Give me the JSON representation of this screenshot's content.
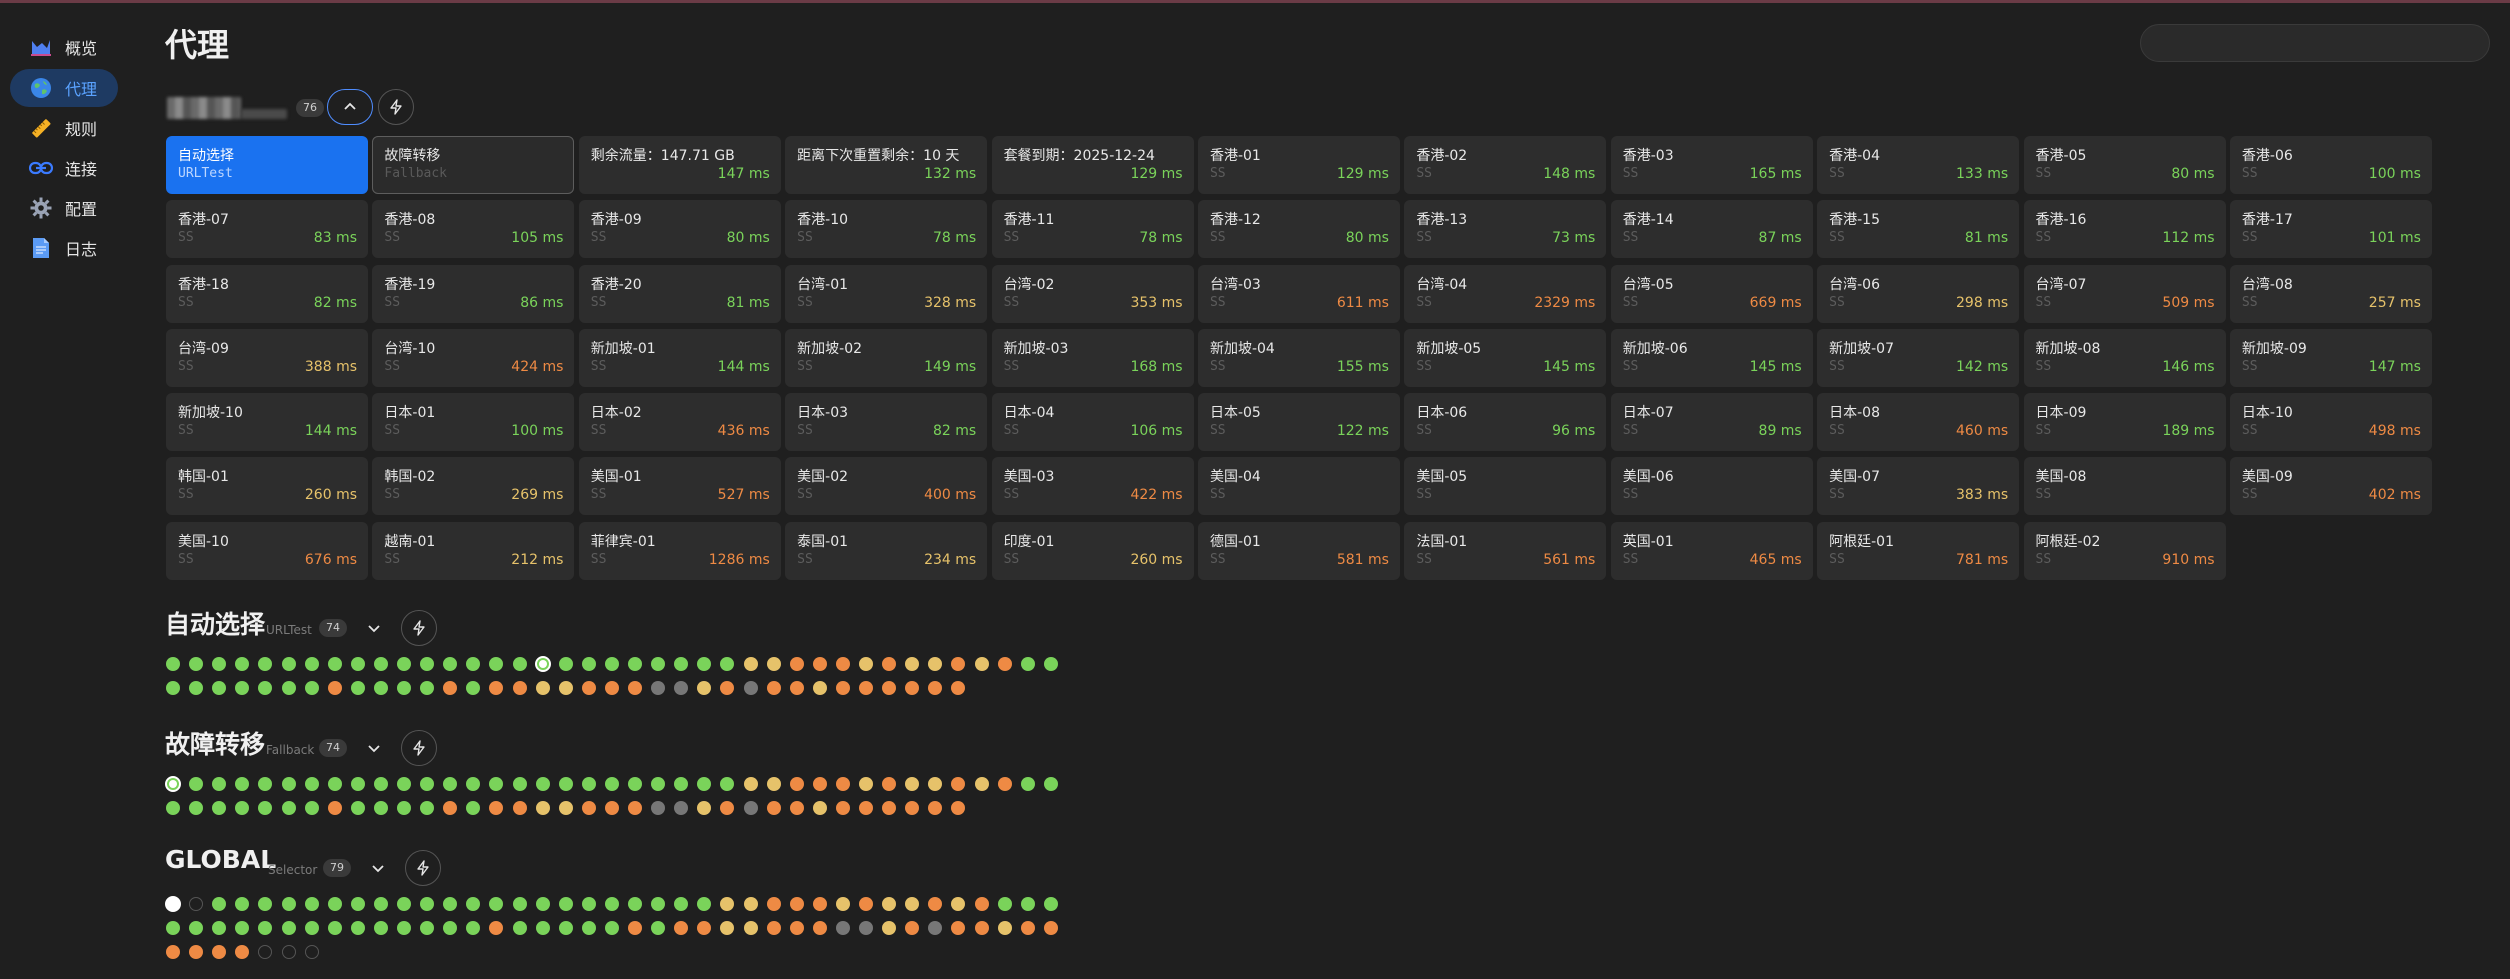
{
  "sidebar": {
    "items": [
      {
        "label": "概览",
        "icon": "chart-icon",
        "color": "#5b8cf0"
      },
      {
        "label": "代理",
        "icon": "globe-icon",
        "color": "#4aa3ff",
        "active": true
      },
      {
        "label": "规则",
        "icon": "ruler-icon",
        "color": "#f5b125"
      },
      {
        "label": "连接",
        "icon": "link-icon",
        "color": "#3b7bff"
      },
      {
        "label": "配置",
        "icon": "gear-icon",
        "color": "#9aa3b5"
      },
      {
        "label": "日志",
        "icon": "document-icon",
        "color": "#6aa6ff"
      }
    ]
  },
  "header": {
    "title": "代理",
    "search_placeholder": ""
  },
  "main_group": {
    "count": "76"
  },
  "colors": {
    "green": "#7ad35a",
    "yellow": "#e6c26a",
    "orange": "#ee8a44",
    "empty": "#555555"
  },
  "proxies": [
    {
      "name": "自动选择",
      "type": "URLTest",
      "latency": "",
      "state": "selected"
    },
    {
      "name": "故障转移",
      "type": "Fallback",
      "latency": "",
      "state": "outlined"
    },
    {
      "name": "剩余流量：147.71 GB",
      "type": "",
      "latency": "147 ms",
      "level": "green"
    },
    {
      "name": "距离下次重置剩余：10 天",
      "type": "",
      "latency": "132 ms",
      "level": "green"
    },
    {
      "name": "套餐到期：2025-12-24",
      "type": "",
      "latency": "129 ms",
      "level": "green"
    },
    {
      "name": "香港-01",
      "type": "SS",
      "latency": "129 ms",
      "level": "green"
    },
    {
      "name": "香港-02",
      "type": "SS",
      "latency": "148 ms",
      "level": "green"
    },
    {
      "name": "香港-03",
      "type": "SS",
      "latency": "165 ms",
      "level": "green"
    },
    {
      "name": "香港-04",
      "type": "SS",
      "latency": "133 ms",
      "level": "green"
    },
    {
      "name": "香港-05",
      "type": "SS",
      "latency": "80 ms",
      "level": "green"
    },
    {
      "name": "香港-06",
      "type": "SS",
      "latency": "100 ms",
      "level": "green"
    },
    {
      "name": "香港-07",
      "type": "SS",
      "latency": "83 ms",
      "level": "green"
    },
    {
      "name": "香港-08",
      "type": "SS",
      "latency": "105 ms",
      "level": "green"
    },
    {
      "name": "香港-09",
      "type": "SS",
      "latency": "80 ms",
      "level": "green"
    },
    {
      "name": "香港-10",
      "type": "SS",
      "latency": "78 ms",
      "level": "green"
    },
    {
      "name": "香港-11",
      "type": "SS",
      "latency": "78 ms",
      "level": "green"
    },
    {
      "name": "香港-12",
      "type": "SS",
      "latency": "80 ms",
      "level": "green"
    },
    {
      "name": "香港-13",
      "type": "SS",
      "latency": "73 ms",
      "level": "green"
    },
    {
      "name": "香港-14",
      "type": "SS",
      "latency": "87 ms",
      "level": "green"
    },
    {
      "name": "香港-15",
      "type": "SS",
      "latency": "81 ms",
      "level": "green"
    },
    {
      "name": "香港-16",
      "type": "SS",
      "latency": "112 ms",
      "level": "green"
    },
    {
      "name": "香港-17",
      "type": "SS",
      "latency": "101 ms",
      "level": "green"
    },
    {
      "name": "香港-18",
      "type": "SS",
      "latency": "82 ms",
      "level": "green"
    },
    {
      "name": "香港-19",
      "type": "SS",
      "latency": "86 ms",
      "level": "green"
    },
    {
      "name": "香港-20",
      "type": "SS",
      "latency": "81 ms",
      "level": "green"
    },
    {
      "name": "台湾-01",
      "type": "SS",
      "latency": "328 ms",
      "level": "yellow"
    },
    {
      "name": "台湾-02",
      "type": "SS",
      "latency": "353 ms",
      "level": "yellow"
    },
    {
      "name": "台湾-03",
      "type": "SS",
      "latency": "611 ms",
      "level": "orange"
    },
    {
      "name": "台湾-04",
      "type": "SS",
      "latency": "2329 ms",
      "level": "orange"
    },
    {
      "name": "台湾-05",
      "type": "SS",
      "latency": "669 ms",
      "level": "orange"
    },
    {
      "name": "台湾-06",
      "type": "SS",
      "latency": "298 ms",
      "level": "yellow"
    },
    {
      "name": "台湾-07",
      "type": "SS",
      "latency": "509 ms",
      "level": "orange"
    },
    {
      "name": "台湾-08",
      "type": "SS",
      "latency": "257 ms",
      "level": "yellow"
    },
    {
      "name": "台湾-09",
      "type": "SS",
      "latency": "388 ms",
      "level": "yellow"
    },
    {
      "name": "台湾-10",
      "type": "SS",
      "latency": "424 ms",
      "level": "orange"
    },
    {
      "name": "新加坡-01",
      "type": "SS",
      "latency": "144 ms",
      "level": "green"
    },
    {
      "name": "新加坡-02",
      "type": "SS",
      "latency": "149 ms",
      "level": "green"
    },
    {
      "name": "新加坡-03",
      "type": "SS",
      "latency": "168 ms",
      "level": "green"
    },
    {
      "name": "新加坡-04",
      "type": "SS",
      "latency": "155 ms",
      "level": "green"
    },
    {
      "name": "新加坡-05",
      "type": "SS",
      "latency": "145 ms",
      "level": "green"
    },
    {
      "name": "新加坡-06",
      "type": "SS",
      "latency": "145 ms",
      "level": "green"
    },
    {
      "name": "新加坡-07",
      "type": "SS",
      "latency": "142 ms",
      "level": "green"
    },
    {
      "name": "新加坡-08",
      "type": "SS",
      "latency": "146 ms",
      "level": "green"
    },
    {
      "name": "新加坡-09",
      "type": "SS",
      "latency": "147 ms",
      "level": "green"
    },
    {
      "name": "新加坡-10",
      "type": "SS",
      "latency": "144 ms",
      "level": "green"
    },
    {
      "name": "日本-01",
      "type": "SS",
      "latency": "100 ms",
      "level": "green"
    },
    {
      "name": "日本-02",
      "type": "SS",
      "latency": "436 ms",
      "level": "orange"
    },
    {
      "name": "日本-03",
      "type": "SS",
      "latency": "82 ms",
      "level": "green"
    },
    {
      "name": "日本-04",
      "type": "SS",
      "latency": "106 ms",
      "level": "green"
    },
    {
      "name": "日本-05",
      "type": "SS",
      "latency": "122 ms",
      "level": "green"
    },
    {
      "name": "日本-06",
      "type": "SS",
      "latency": "96 ms",
      "level": "green"
    },
    {
      "name": "日本-07",
      "type": "SS",
      "latency": "89 ms",
      "level": "green"
    },
    {
      "name": "日本-08",
      "type": "SS",
      "latency": "460 ms",
      "level": "orange"
    },
    {
      "name": "日本-09",
      "type": "SS",
      "latency": "189 ms",
      "level": "green"
    },
    {
      "name": "日本-10",
      "type": "SS",
      "latency": "498 ms",
      "level": "orange"
    },
    {
      "name": "韩国-01",
      "type": "SS",
      "latency": "260 ms",
      "level": "yellow"
    },
    {
      "name": "韩国-02",
      "type": "SS",
      "latency": "269 ms",
      "level": "yellow"
    },
    {
      "name": "美国-01",
      "type": "SS",
      "latency": "527 ms",
      "level": "orange"
    },
    {
      "name": "美国-02",
      "type": "SS",
      "latency": "400 ms",
      "level": "orange"
    },
    {
      "name": "美国-03",
      "type": "SS",
      "latency": "422 ms",
      "level": "orange"
    },
    {
      "name": "美国-04",
      "type": "SS",
      "latency": "",
      "level": "none"
    },
    {
      "name": "美国-05",
      "type": "SS",
      "latency": "",
      "level": "none"
    },
    {
      "name": "美国-06",
      "type": "SS",
      "latency": "",
      "level": "none"
    },
    {
      "name": "美国-07",
      "type": "SS",
      "latency": "383 ms",
      "level": "yellow"
    },
    {
      "name": "美国-08",
      "type": "SS",
      "latency": "",
      "level": "none"
    },
    {
      "name": "美国-09",
      "type": "SS",
      "latency": "402 ms",
      "level": "orange"
    },
    {
      "name": "美国-10",
      "type": "SS",
      "latency": "676 ms",
      "level": "orange"
    },
    {
      "name": "越南-01",
      "type": "SS",
      "latency": "212 ms",
      "level": "yellow"
    },
    {
      "name": "菲律宾-01",
      "type": "SS",
      "latency": "1286 ms",
      "level": "orange"
    },
    {
      "name": "泰国-01",
      "type": "SS",
      "latency": "234 ms",
      "level": "yellow"
    },
    {
      "name": "印度-01",
      "type": "SS",
      "latency": "260 ms",
      "level": "yellow"
    },
    {
      "name": "德国-01",
      "type": "SS",
      "latency": "581 ms",
      "level": "orange"
    },
    {
      "name": "法国-01",
      "type": "SS",
      "latency": "561 ms",
      "level": "orange"
    },
    {
      "name": "英国-01",
      "type": "SS",
      "latency": "465 ms",
      "level": "orange"
    },
    {
      "name": "阿根廷-01",
      "type": "SS",
      "latency": "781 ms",
      "level": "orange"
    },
    {
      "name": "阿根廷-02",
      "type": "SS",
      "latency": "910 ms",
      "level": "orange"
    }
  ],
  "groups": [
    {
      "title": "自动选择",
      "type": "URLTest",
      "count": "74",
      "dots": [
        "g",
        "g",
        "g",
        "g",
        "g",
        "g",
        "g",
        "g",
        "g",
        "g",
        "g",
        "g",
        "g",
        "g",
        "g",
        "g",
        "G",
        "g",
        "g",
        "g",
        "g",
        "g",
        "g",
        "g",
        "g",
        "y",
        "y",
        "o",
        "o",
        "o",
        "y",
        "o",
        "y",
        "y",
        "o",
        "y",
        "o",
        "g",
        "g",
        "g",
        "g",
        "g",
        "g",
        "g",
        "g",
        "g",
        "o",
        "g",
        "g",
        "g",
        "g",
        "o",
        "g",
        "o",
        "o",
        "y",
        "y",
        "o",
        "o",
        "o",
        "e",
        "e",
        "y",
        "o",
        "e",
        "o",
        "o",
        "y",
        "o",
        "o",
        "o",
        "o",
        "o",
        "o"
      ],
      "current_index": 16
    },
    {
      "title": "故障转移",
      "type": "Fallback",
      "count": "74",
      "dots": [
        "G",
        "g",
        "g",
        "g",
        "g",
        "g",
        "g",
        "g",
        "g",
        "g",
        "g",
        "g",
        "g",
        "g",
        "g",
        "g",
        "g",
        "g",
        "g",
        "g",
        "g",
        "g",
        "g",
        "g",
        "g",
        "y",
        "y",
        "o",
        "o",
        "o",
        "y",
        "o",
        "y",
        "y",
        "o",
        "y",
        "o",
        "g",
        "g",
        "g",
        "g",
        "g",
        "g",
        "g",
        "g",
        "g",
        "o",
        "g",
        "g",
        "g",
        "g",
        "o",
        "g",
        "o",
        "o",
        "y",
        "y",
        "o",
        "o",
        "o",
        "e",
        "e",
        "y",
        "o",
        "e",
        "o",
        "o",
        "y",
        "o",
        "o",
        "o",
        "o",
        "o",
        "o"
      ],
      "current_index": 0
    },
    {
      "title": "GLOBAL",
      "type": "Selector",
      "count": "79",
      "dots": [
        "W",
        "x",
        "g",
        "g",
        "g",
        "g",
        "g",
        "g",
        "g",
        "g",
        "g",
        "g",
        "g",
        "g",
        "g",
        "g",
        "g",
        "g",
        "g",
        "g",
        "g",
        "g",
        "g",
        "g",
        "y",
        "y",
        "o",
        "o",
        "o",
        "y",
        "o",
        "y",
        "y",
        "o",
        "y",
        "o",
        "g",
        "g",
        "g",
        "g",
        "g",
        "g",
        "g",
        "g",
        "g",
        "g",
        "g",
        "g",
        "g",
        "g",
        "g",
        "g",
        "g",
        "o",
        "g",
        "g",
        "g",
        "g",
        "g",
        "o",
        "g",
        "o",
        "o",
        "y",
        "y",
        "o",
        "o",
        "o",
        "e",
        "e",
        "y",
        "o",
        "e",
        "o",
        "o",
        "y",
        "o",
        "o",
        "o",
        "o",
        "o",
        "o",
        "x",
        "x",
        "x"
      ],
      "current_index": 0
    }
  ]
}
